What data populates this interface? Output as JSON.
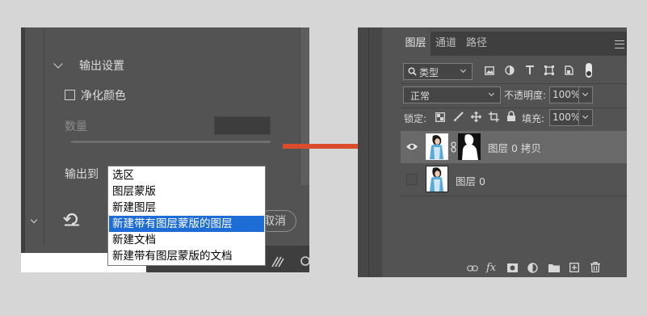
{
  "left_panel": {
    "section_title": "输出设置",
    "decontaminate_label": "净化颜色",
    "amount_label": "数量",
    "output_to_label": "输出到",
    "cancel_label": "取消",
    "dropdown_options": [
      "选区",
      "图层蒙版",
      "新建图层",
      "新建带有图层蒙版的图层",
      "新建文档",
      "新建带有图层蒙版的文档"
    ],
    "selected_option": "新建带有图层蒙版的图层"
  },
  "layers_panel": {
    "tabs": [
      "图层",
      "通道",
      "路径"
    ],
    "active_tab": "图层",
    "filter_kind": "类型",
    "blend_mode": "正常",
    "opacity_label": "不透明度:",
    "opacity_value": "100%",
    "lock_label": "锁定:",
    "fill_label": "填充:",
    "fill_value": "100%",
    "layers": [
      {
        "name": "图层 0 拷贝",
        "visible": true,
        "has_mask": true,
        "selected": true
      },
      {
        "name": "图层 0",
        "visible": false,
        "has_mask": false,
        "selected": false
      }
    ]
  },
  "colors": {
    "arrow": "#db4b2c",
    "dropdown_highlight": "#1e6cd6",
    "panel_bg": "#535353",
    "page_bg": "#d6d6d6"
  }
}
